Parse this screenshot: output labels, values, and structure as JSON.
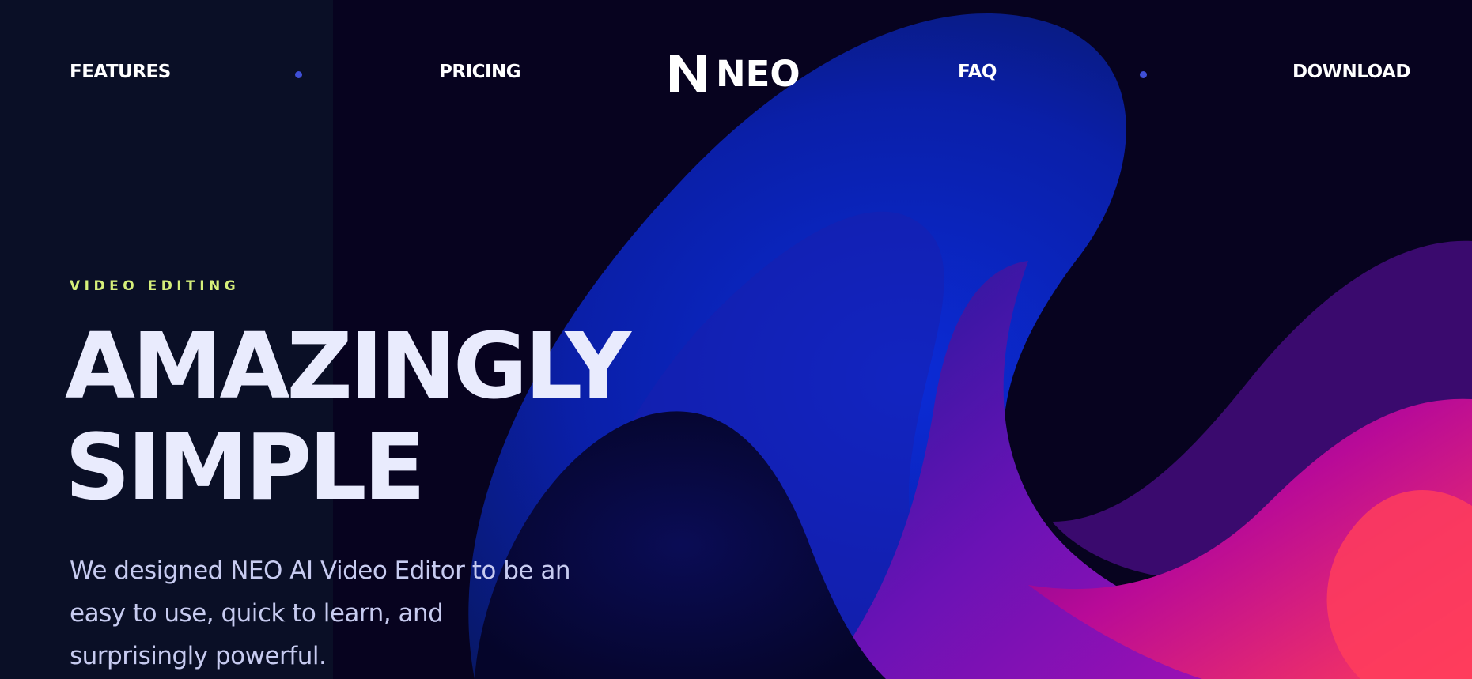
{
  "nav": {
    "left": [
      {
        "label": "FEATURES"
      },
      {
        "label": "PRICING"
      }
    ],
    "right": [
      {
        "label": "FAQ"
      },
      {
        "label": "DOWNLOAD"
      }
    ],
    "dot_color": "#3f4fd6"
  },
  "logo": {
    "mark_icon": "n-letter-logo-icon",
    "text": "NEO"
  },
  "hero": {
    "eyebrow": "VIDEO EDITING",
    "eyebrow_color": "#d6ef7a",
    "headline_lines": [
      "AMAZINGLY",
      "SIMPLE"
    ],
    "body_lines": [
      "We designed NEO AI Video Editor to be an",
      "easy to use, quick to learn, and",
      "surprisingly powerful."
    ]
  },
  "colors": {
    "background": "#07031f",
    "left_panel": "#0a0f26",
    "headline": "#e9ebfd",
    "body": "#c7cbf0",
    "wave_blue": "#0b2bd6",
    "wave_purple": "#7a0fb8",
    "wave_pink": "#ff3a6a"
  }
}
